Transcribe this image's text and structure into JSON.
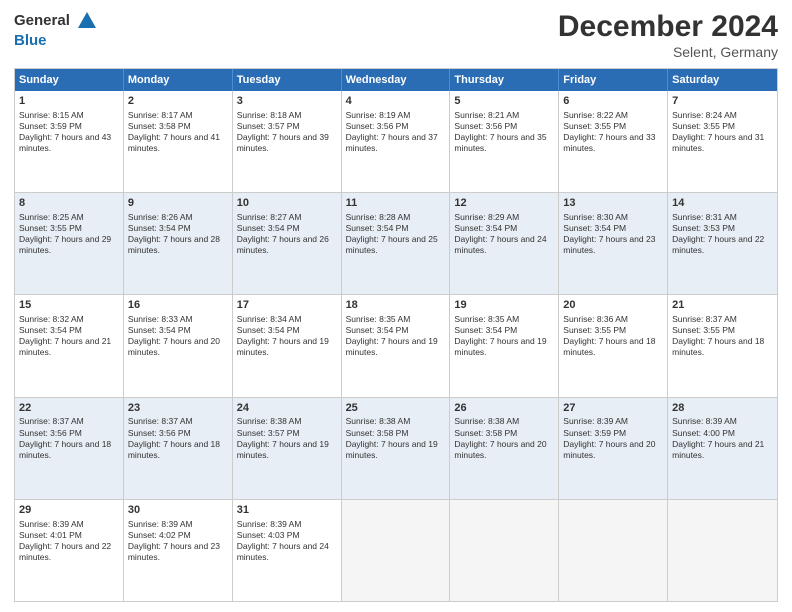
{
  "header": {
    "logo_general": "General",
    "logo_blue": "Blue",
    "month_title": "December 2024",
    "location": "Selent, Germany"
  },
  "weekdays": [
    "Sunday",
    "Monday",
    "Tuesday",
    "Wednesday",
    "Thursday",
    "Friday",
    "Saturday"
  ],
  "rows": [
    {
      "shaded": false,
      "cells": [
        {
          "day": "1",
          "sunrise": "Sunrise: 8:15 AM",
          "sunset": "Sunset: 3:59 PM",
          "daylight": "Daylight: 7 hours and 43 minutes."
        },
        {
          "day": "2",
          "sunrise": "Sunrise: 8:17 AM",
          "sunset": "Sunset: 3:58 PM",
          "daylight": "Daylight: 7 hours and 41 minutes."
        },
        {
          "day": "3",
          "sunrise": "Sunrise: 8:18 AM",
          "sunset": "Sunset: 3:57 PM",
          "daylight": "Daylight: 7 hours and 39 minutes."
        },
        {
          "day": "4",
          "sunrise": "Sunrise: 8:19 AM",
          "sunset": "Sunset: 3:56 PM",
          "daylight": "Daylight: 7 hours and 37 minutes."
        },
        {
          "day": "5",
          "sunrise": "Sunrise: 8:21 AM",
          "sunset": "Sunset: 3:56 PM",
          "daylight": "Daylight: 7 hours and 35 minutes."
        },
        {
          "day": "6",
          "sunrise": "Sunrise: 8:22 AM",
          "sunset": "Sunset: 3:55 PM",
          "daylight": "Daylight: 7 hours and 33 minutes."
        },
        {
          "day": "7",
          "sunrise": "Sunrise: 8:24 AM",
          "sunset": "Sunset: 3:55 PM",
          "daylight": "Daylight: 7 hours and 31 minutes."
        }
      ]
    },
    {
      "shaded": true,
      "cells": [
        {
          "day": "8",
          "sunrise": "Sunrise: 8:25 AM",
          "sunset": "Sunset: 3:55 PM",
          "daylight": "Daylight: 7 hours and 29 minutes."
        },
        {
          "day": "9",
          "sunrise": "Sunrise: 8:26 AM",
          "sunset": "Sunset: 3:54 PM",
          "daylight": "Daylight: 7 hours and 28 minutes."
        },
        {
          "day": "10",
          "sunrise": "Sunrise: 8:27 AM",
          "sunset": "Sunset: 3:54 PM",
          "daylight": "Daylight: 7 hours and 26 minutes."
        },
        {
          "day": "11",
          "sunrise": "Sunrise: 8:28 AM",
          "sunset": "Sunset: 3:54 PM",
          "daylight": "Daylight: 7 hours and 25 minutes."
        },
        {
          "day": "12",
          "sunrise": "Sunrise: 8:29 AM",
          "sunset": "Sunset: 3:54 PM",
          "daylight": "Daylight: 7 hours and 24 minutes."
        },
        {
          "day": "13",
          "sunrise": "Sunrise: 8:30 AM",
          "sunset": "Sunset: 3:54 PM",
          "daylight": "Daylight: 7 hours and 23 minutes."
        },
        {
          "day": "14",
          "sunrise": "Sunrise: 8:31 AM",
          "sunset": "Sunset: 3:53 PM",
          "daylight": "Daylight: 7 hours and 22 minutes."
        }
      ]
    },
    {
      "shaded": false,
      "cells": [
        {
          "day": "15",
          "sunrise": "Sunrise: 8:32 AM",
          "sunset": "Sunset: 3:54 PM",
          "daylight": "Daylight: 7 hours and 21 minutes."
        },
        {
          "day": "16",
          "sunrise": "Sunrise: 8:33 AM",
          "sunset": "Sunset: 3:54 PM",
          "daylight": "Daylight: 7 hours and 20 minutes."
        },
        {
          "day": "17",
          "sunrise": "Sunrise: 8:34 AM",
          "sunset": "Sunset: 3:54 PM",
          "daylight": "Daylight: 7 hours and 19 minutes."
        },
        {
          "day": "18",
          "sunrise": "Sunrise: 8:35 AM",
          "sunset": "Sunset: 3:54 PM",
          "daylight": "Daylight: 7 hours and 19 minutes."
        },
        {
          "day": "19",
          "sunrise": "Sunrise: 8:35 AM",
          "sunset": "Sunset: 3:54 PM",
          "daylight": "Daylight: 7 hours and 19 minutes."
        },
        {
          "day": "20",
          "sunrise": "Sunrise: 8:36 AM",
          "sunset": "Sunset: 3:55 PM",
          "daylight": "Daylight: 7 hours and 18 minutes."
        },
        {
          "day": "21",
          "sunrise": "Sunrise: 8:37 AM",
          "sunset": "Sunset: 3:55 PM",
          "daylight": "Daylight: 7 hours and 18 minutes."
        }
      ]
    },
    {
      "shaded": true,
      "cells": [
        {
          "day": "22",
          "sunrise": "Sunrise: 8:37 AM",
          "sunset": "Sunset: 3:56 PM",
          "daylight": "Daylight: 7 hours and 18 minutes."
        },
        {
          "day": "23",
          "sunrise": "Sunrise: 8:37 AM",
          "sunset": "Sunset: 3:56 PM",
          "daylight": "Daylight: 7 hours and 18 minutes."
        },
        {
          "day": "24",
          "sunrise": "Sunrise: 8:38 AM",
          "sunset": "Sunset: 3:57 PM",
          "daylight": "Daylight: 7 hours and 19 minutes."
        },
        {
          "day": "25",
          "sunrise": "Sunrise: 8:38 AM",
          "sunset": "Sunset: 3:58 PM",
          "daylight": "Daylight: 7 hours and 19 minutes."
        },
        {
          "day": "26",
          "sunrise": "Sunrise: 8:38 AM",
          "sunset": "Sunset: 3:58 PM",
          "daylight": "Daylight: 7 hours and 20 minutes."
        },
        {
          "day": "27",
          "sunrise": "Sunrise: 8:39 AM",
          "sunset": "Sunset: 3:59 PM",
          "daylight": "Daylight: 7 hours and 20 minutes."
        },
        {
          "day": "28",
          "sunrise": "Sunrise: 8:39 AM",
          "sunset": "Sunset: 4:00 PM",
          "daylight": "Daylight: 7 hours and 21 minutes."
        }
      ]
    },
    {
      "shaded": false,
      "cells": [
        {
          "day": "29",
          "sunrise": "Sunrise: 8:39 AM",
          "sunset": "Sunset: 4:01 PM",
          "daylight": "Daylight: 7 hours and 22 minutes."
        },
        {
          "day": "30",
          "sunrise": "Sunrise: 8:39 AM",
          "sunset": "Sunset: 4:02 PM",
          "daylight": "Daylight: 7 hours and 23 minutes."
        },
        {
          "day": "31",
          "sunrise": "Sunrise: 8:39 AM",
          "sunset": "Sunset: 4:03 PM",
          "daylight": "Daylight: 7 hours and 24 minutes."
        },
        {
          "day": "",
          "sunrise": "",
          "sunset": "",
          "daylight": ""
        },
        {
          "day": "",
          "sunrise": "",
          "sunset": "",
          "daylight": ""
        },
        {
          "day": "",
          "sunrise": "",
          "sunset": "",
          "daylight": ""
        },
        {
          "day": "",
          "sunrise": "",
          "sunset": "",
          "daylight": ""
        }
      ]
    }
  ]
}
